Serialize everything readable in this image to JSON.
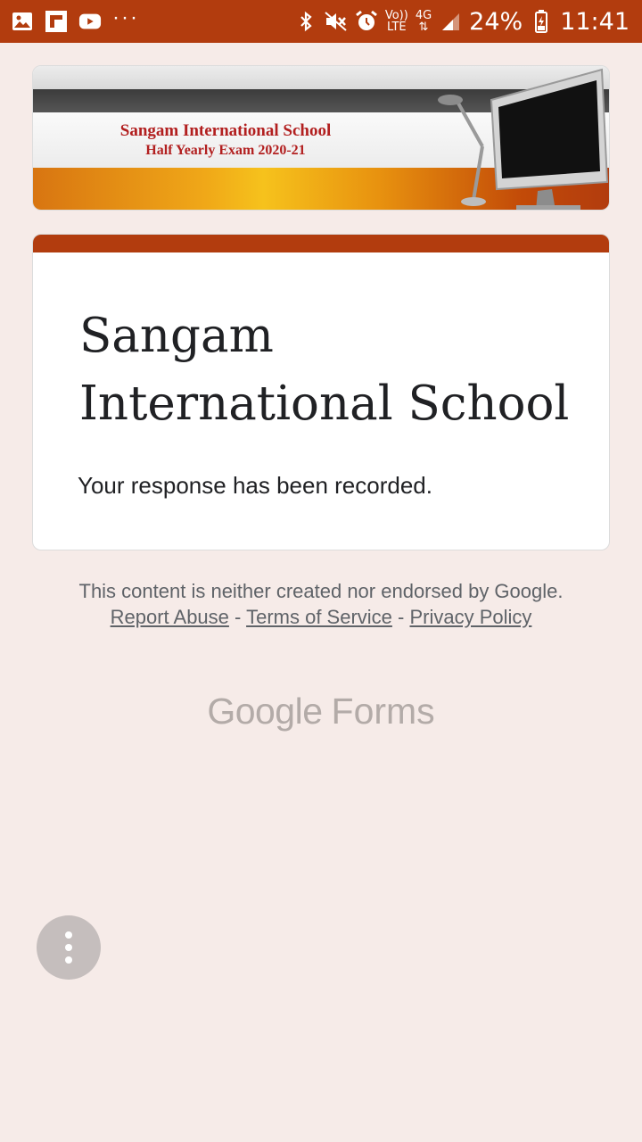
{
  "status_bar": {
    "left_icons": [
      "gallery-icon",
      "flipboard-icon",
      "youtube-icon",
      "more-dots-icon"
    ],
    "more_dots": "···",
    "volte_top": "Vo))",
    "volte_bottom": "LTE",
    "network": "4G",
    "battery": "24%",
    "time": "11:41",
    "background": "#b23c0e"
  },
  "banner": {
    "title": "Sangam International School",
    "subtitle": "Half Yearly Exam 2020-21"
  },
  "card": {
    "title": "Sangam International School",
    "message": "Your response has been recorded.",
    "accent": "#b23c0e"
  },
  "footer": {
    "disclaimer": "This content is neither created nor endorsed by Google.",
    "report_abuse": "Report Abuse",
    "separator": "-",
    "terms": "Terms of Service",
    "privacy": "Privacy Policy"
  },
  "brand": {
    "google": "Google",
    "forms": "Forms"
  },
  "fab": {
    "icon": "more-vert-icon"
  }
}
